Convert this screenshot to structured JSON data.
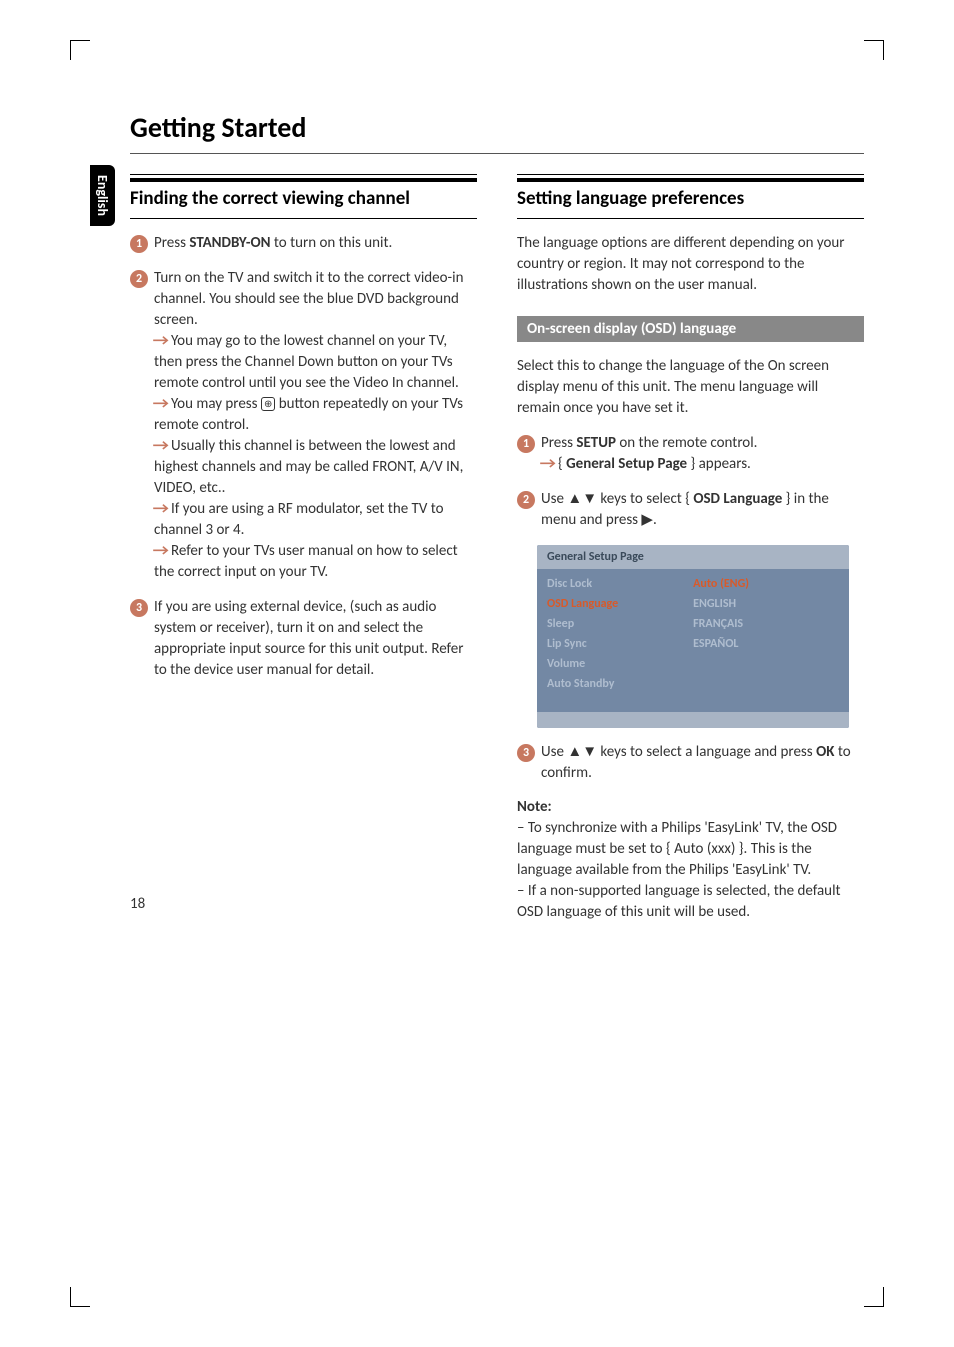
{
  "side_tab": "English",
  "page_title": "Getting Started",
  "page_number": "18",
  "left": {
    "heading": "Finding the correct viewing channel",
    "step1_a": "Press ",
    "step1_b": "STANDBY-ON",
    "step1_c": " to turn on this unit.",
    "step2_intro": "Turn on the TV and switch it to the correct video-in channel. You should see the blue DVD background screen.",
    "step2_b1": " You may go to the lowest channel on your TV, then press the Channel Down button on your TVs remote control until you see the Video In channel.",
    "step2_b2a": " You may press ",
    "step2_b2b": " button repeatedly on your TVs remote control.",
    "step2_b3": " Usually this channel is between the lowest and highest channels and may be called FRONT, A/V IN, VIDEO, etc..",
    "step2_b4": " If you are using a RF modulator, set the TV to channel 3 or 4.",
    "step2_b5": " Refer to your TVs user manual on how to select the correct input on your TV.",
    "step3": "If you are using external device, (such as audio system or receiver), turn it on and select the appropriate input source for this unit output. Refer to the device user manual for detail."
  },
  "right": {
    "heading": "Setting language preferences",
    "intro": "The language options are different depending on your country or region. It may not correspond to the illustrations shown on the user manual.",
    "sub_heading": "On-screen display (OSD) language",
    "sub_intro": "Select this to change the language of the On screen display menu of this unit. The menu language will remain once you have set it.",
    "step1_a": "Press ",
    "step1_b": "SETUP",
    "step1_c": " on the remote control.",
    "step1_result_a": " { ",
    "step1_result_b": "General Setup Page",
    "step1_result_c": " } appears.",
    "step2_a": "Use ▲▼ keys to select { ",
    "step2_b": "OSD Language",
    "step2_c": " } in the menu and press ▶.",
    "step3_a": "Use ▲▼ keys to select a language and press ",
    "step3_b": "OK",
    "step3_c": " to confirm.",
    "note_label": "Note:",
    "note_body": "–  To synchronize with a Philips 'EasyLink' TV, the OSD language must be set to { Auto (xxx) }. This is the language available from the Philips 'EasyLink' TV.\n–  If a non-supported language is selected, the default OSD language of this unit will be used.",
    "menu": {
      "title": "General Setup Page",
      "left_items": [
        "Disc Lock",
        "OSD Language",
        "Sleep",
        "Lip Sync",
        "Volume",
        "Auto Standby"
      ],
      "right_items": [
        "Auto (ENG)",
        "ENGLISH",
        "FRANÇAIS",
        "ESPAÑOL"
      ],
      "active_left": 1,
      "active_right": 0
    }
  }
}
